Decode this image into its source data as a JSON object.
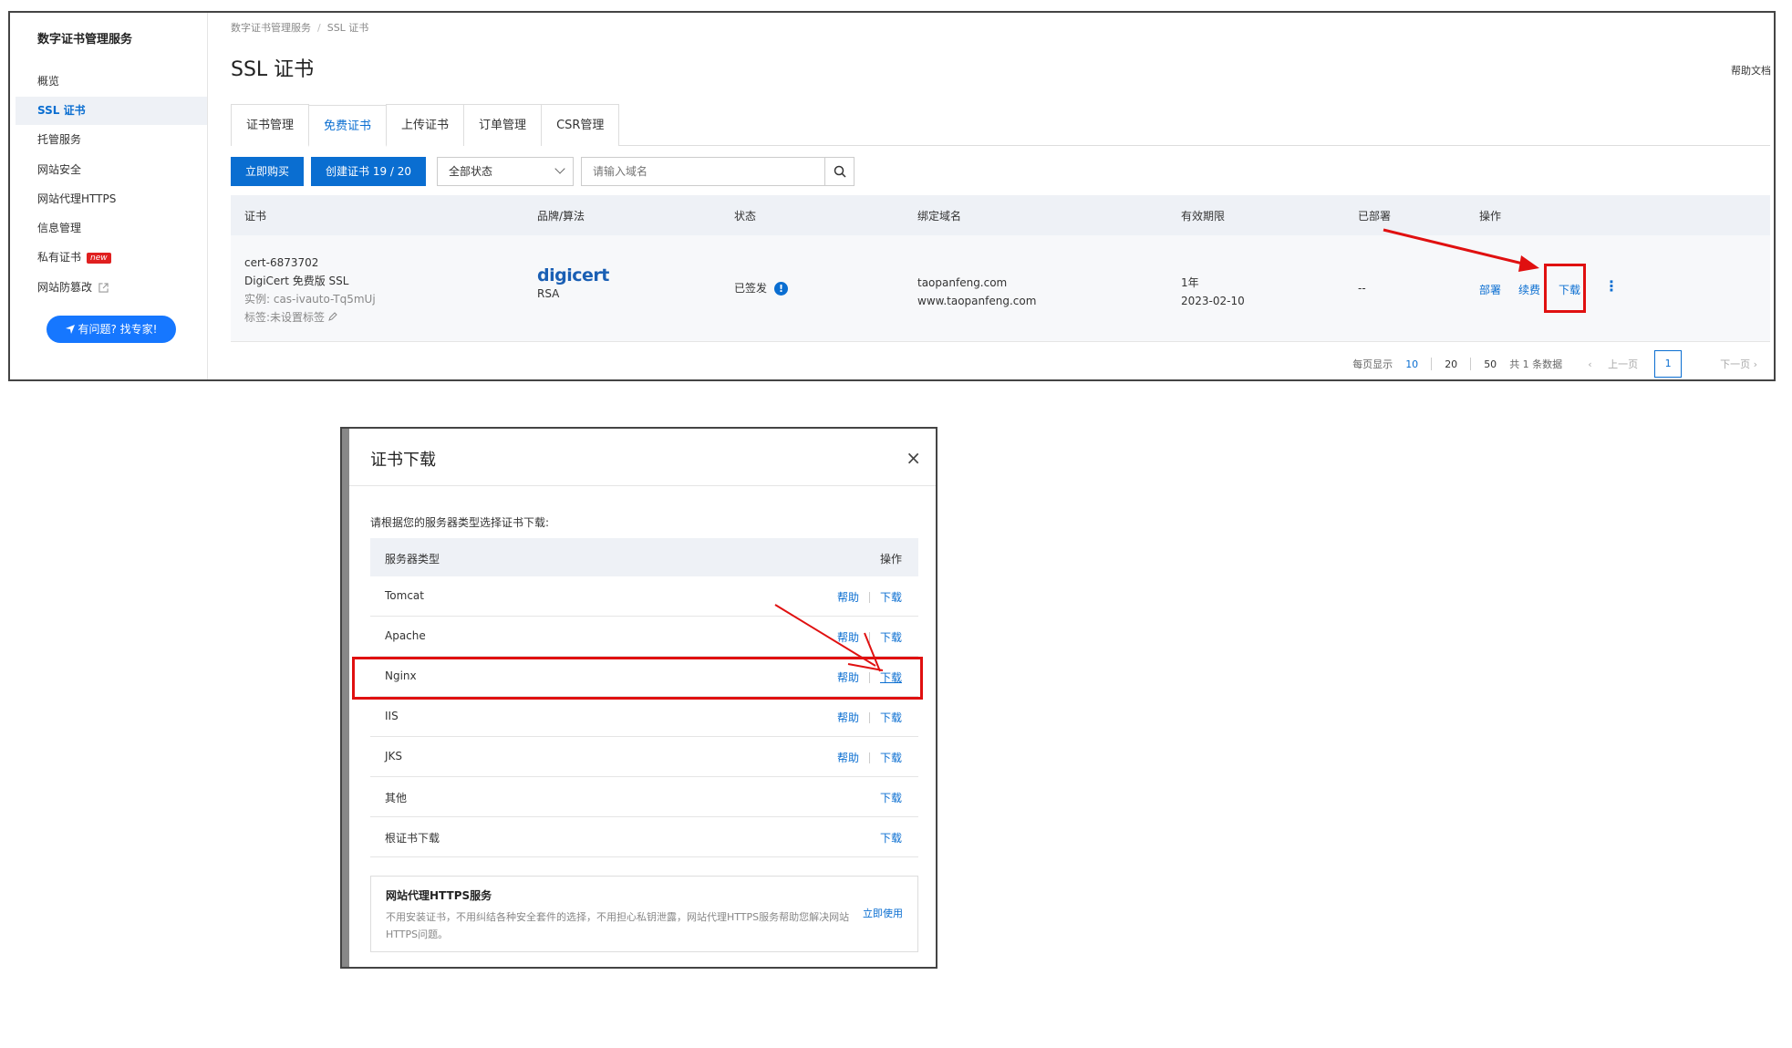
{
  "sidebar": {
    "title": "数字证书管理服务",
    "items": [
      {
        "label": "概览"
      },
      {
        "label": "SSL 证书"
      },
      {
        "label": "托管服务"
      },
      {
        "label": "网站安全"
      },
      {
        "label": "网站代理HTTPS"
      },
      {
        "label": "信息管理"
      },
      {
        "label": "私有证书",
        "badge": "new"
      },
      {
        "label": "网站防篡改"
      }
    ],
    "help_button": "有问题? 找专家!"
  },
  "header": {
    "breadcrumb": [
      "数字证书管理服务",
      "SSL 证书"
    ],
    "title": "SSL 证书",
    "help_doc": "帮助文档"
  },
  "tabs": [
    "证书管理",
    "免费证书",
    "上传证书",
    "订单管理",
    "CSR管理"
  ],
  "toolbar": {
    "buy_button": "立即购买",
    "create_button": "创建证书 19 / 20",
    "status_select": "全部状态",
    "search_placeholder": "请输入域名"
  },
  "table": {
    "columns": [
      "证书",
      "品牌/算法",
      "状态",
      "绑定域名",
      "有效期限",
      "已部署",
      "操作"
    ],
    "row": {
      "cert_id": "cert-6873702",
      "cert_name": "DigiCert 免费版 SSL",
      "instance": "实例: cas-ivauto-Tq5mUj",
      "tag": "标签:未设置标签",
      "brand": "digicert",
      "algorithm": "RSA",
      "status": "已签发",
      "domains": [
        "taopanfeng.com",
        "www.taopanfeng.com"
      ],
      "validity": "1年",
      "expire_date": "2023-02-10",
      "deployed": "--",
      "actions": [
        "部署",
        "续费",
        "下载"
      ]
    }
  },
  "pagination": {
    "per_page_label": "每页显示",
    "sizes": [
      "10",
      "20",
      "50"
    ],
    "total": "共 1 条数据",
    "prev": "上一页",
    "current": "1",
    "next": "下一页"
  },
  "dialog": {
    "title": "证书下载",
    "close": "×",
    "hint": "请根据您的服务器类型选择证书下载:",
    "columns": [
      "服务器类型",
      "操作"
    ],
    "rows": [
      {
        "name": "Tomcat",
        "help": "帮助",
        "download": "下载"
      },
      {
        "name": "Apache",
        "help": "帮助",
        "download": "下载"
      },
      {
        "name": "Nginx",
        "help": "帮助",
        "download": "下载"
      },
      {
        "name": "IIS",
        "help": "帮助",
        "download": "下载"
      },
      {
        "name": "JKS",
        "help": "帮助",
        "download": "下载"
      },
      {
        "name": "其他",
        "download": "下载"
      },
      {
        "name": "根证书下载",
        "download": "下载"
      }
    ],
    "promo": {
      "title": "网站代理HTTPS服务",
      "text": "不用安装证书，不用纠结各种安全套件的选择，不用担心私钥泄露，网站代理HTTPS服务帮助您解决网站HTTPS问题。",
      "link": "立即使用"
    }
  },
  "colors": {
    "primary": "#0a6ed1",
    "annotation": "#e01010",
    "badge": "#e02020"
  }
}
